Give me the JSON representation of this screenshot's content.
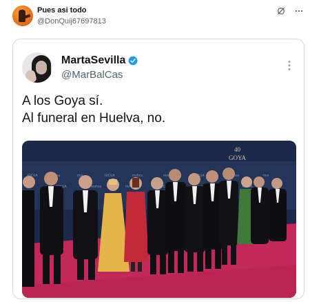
{
  "outer_tweet": {
    "display_name": "Pues asi todo",
    "handle": "@DonQuij67697813"
  },
  "quoted_tweet": {
    "display_name": "MartaSevilla",
    "handle": "@MarBalCas",
    "text_lines": [
      "A los Goya sí.",
      "Al funeral en Huelva, no."
    ]
  },
  "media": {
    "backdrop_logo_number": "40",
    "backdrop_logo_word": "GOYA"
  },
  "colors": {
    "verified": "#1d9bf0",
    "carpet": "#c4285a",
    "backdrop": "#1b2a4a"
  },
  "icons": {
    "mute": "mute-icon",
    "more": "more-icon",
    "verified": "verified-badge-icon"
  }
}
